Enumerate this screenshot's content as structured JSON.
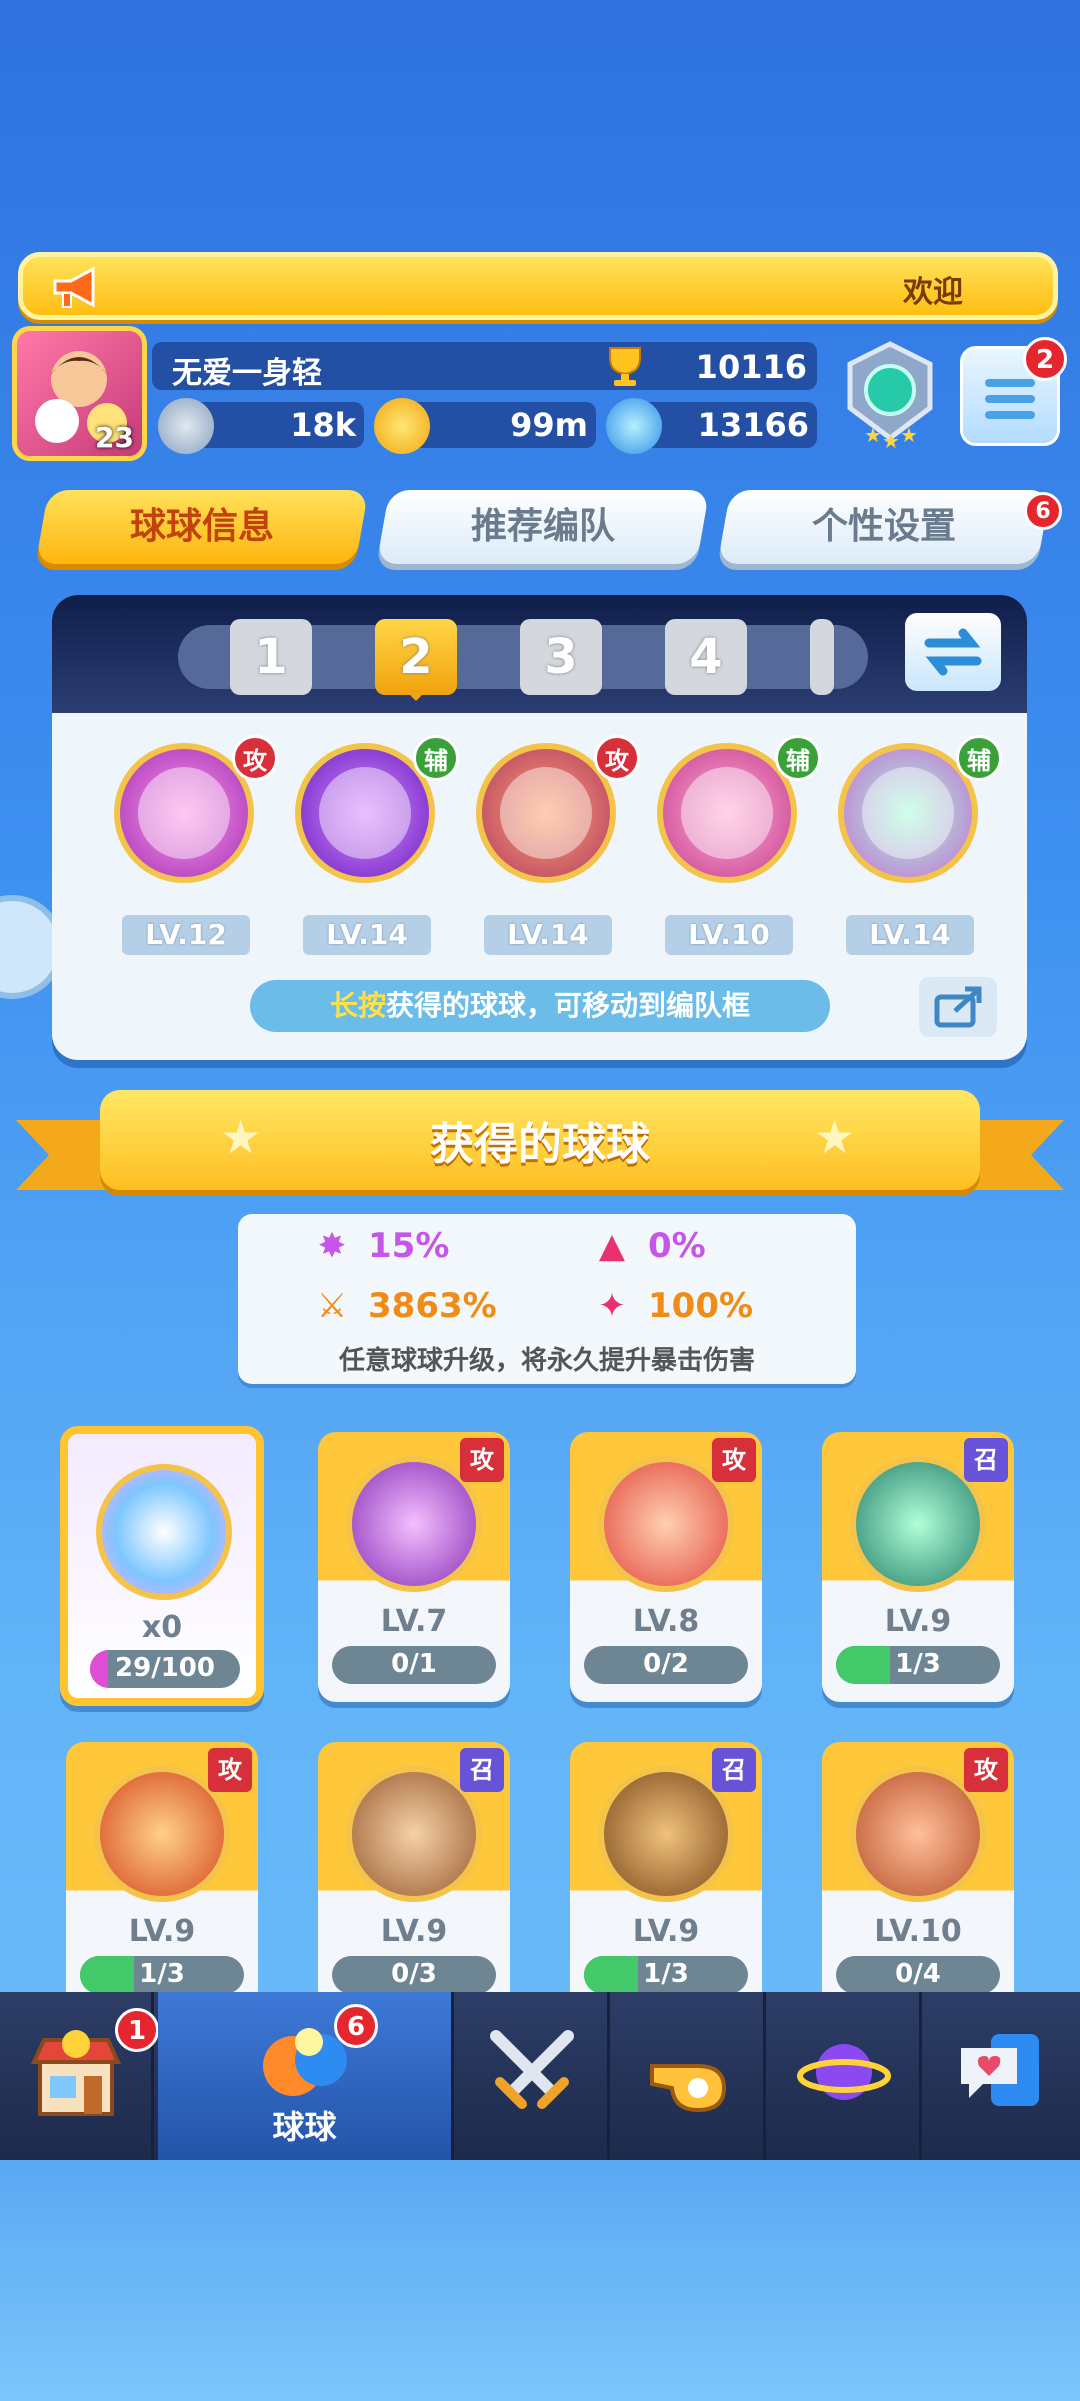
{
  "announce": {
    "text": "欢迎"
  },
  "profile": {
    "level": "23",
    "name": "无爱一身轻",
    "trophies": "10116",
    "resources": {
      "energy": "18k",
      "coins": "99m",
      "gems": "13166"
    },
    "menu_badge": "2"
  },
  "tabs": [
    {
      "label": "球球信息"
    },
    {
      "label": "推荐编队"
    },
    {
      "label": "个性设置",
      "badge": "6"
    }
  ],
  "team": {
    "slots": [
      "1",
      "2",
      "3",
      "4"
    ],
    "selected_slot": "2",
    "balls": [
      {
        "tag": "攻",
        "level": "LV.12"
      },
      {
        "tag": "辅",
        "level": "LV.14"
      },
      {
        "tag": "攻",
        "level": "LV.14"
      },
      {
        "tag": "辅",
        "level": "LV.10"
      },
      {
        "tag": "辅",
        "level": "LV.14"
      }
    ],
    "hint_highlight": "长按",
    "hint_text": "获得的球球，可移动到编队框"
  },
  "section_title": "获得的球球",
  "stats": {
    "items": [
      "15%",
      "0%",
      "3863%",
      "100%"
    ],
    "note": "任意球球升级，将永久提升暴击伤害"
  },
  "cards": [
    {
      "special": true,
      "count": "x0",
      "progress": "29/100",
      "fill": 0.29
    },
    {
      "tag": "攻",
      "level": "LV.7",
      "progress": "0/1",
      "fill": 0
    },
    {
      "tag": "攻",
      "level": "LV.8",
      "progress": "0/2",
      "fill": 0
    },
    {
      "tag": "召",
      "level": "LV.9",
      "progress": "1/3",
      "fill": 0.33
    },
    {
      "tag": "攻",
      "level": "LV.9",
      "progress": "1/3",
      "fill": 0.33
    },
    {
      "tag": "召",
      "level": "LV.9",
      "progress": "0/3",
      "fill": 0
    },
    {
      "tag": "召",
      "level": "LV.9",
      "progress": "1/3",
      "fill": 0.33
    },
    {
      "tag": "攻",
      "level": "LV.10",
      "progress": "0/4",
      "fill": 0
    }
  ],
  "nav": {
    "shop_badge": "1",
    "ball_label": "球球",
    "ball_badge": "6",
    "icons": [
      "shop-icon",
      "ball-icon",
      "battle-swords-icon",
      "whistle-icon",
      "planet-icon",
      "chat-heart-icon"
    ]
  },
  "colors": {
    "accent": "#ffc73a",
    "attack": "#d8303a",
    "support": "#3aa13a",
    "summon": "#6653d8"
  }
}
